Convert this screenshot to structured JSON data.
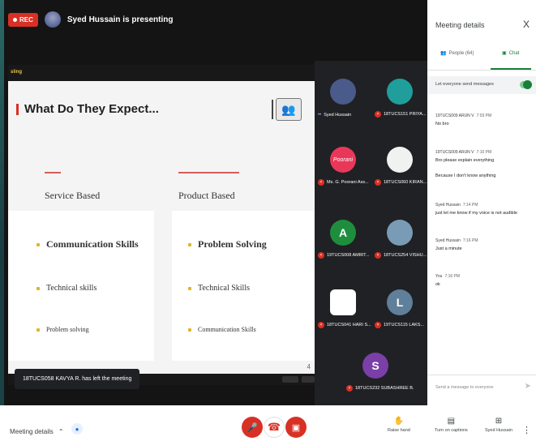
{
  "top": {
    "rec_label": "REC",
    "presenting": "Syed Hussain is presenting"
  },
  "slide": {
    "title": "What Do They Expect...",
    "left_header": "Service Based",
    "right_header": "Product Based",
    "left_items": [
      "Communication Skills",
      "Technical skills",
      "Problem solving"
    ],
    "right_items": [
      "Problem Solving",
      "Technical Skills",
      "Communication Skills"
    ],
    "page_number": "4"
  },
  "toast": "18TUCS058 KAVYA R. has left the meeting",
  "participants": [
    {
      "name": "Syed Hussain",
      "avatar": "",
      "color": "#4a5a8a",
      "muted": false
    },
    {
      "name": "18TUCS151 PRIYA...",
      "avatar": "",
      "color": "#1f9e9b",
      "muted": true
    },
    {
      "name": "Ms. G. Poorani Ass...",
      "avatar": "Poorani",
      "color": "#e8385a",
      "muted": true
    },
    {
      "name": "18TUCS060 KIRAN...",
      "avatar": "",
      "color": "#f1f1f1",
      "muted": true
    },
    {
      "name": "19TUCS008 AMIRT...",
      "avatar": "A",
      "color": "#1e8e3e",
      "muted": true
    },
    {
      "name": "18TUCS254 VISHU...",
      "avatar": "",
      "color": "#7a9bb5",
      "muted": true
    },
    {
      "name": "18TUCS041 HARI S...",
      "avatar": "",
      "color": "#ffffff",
      "muted": true
    },
    {
      "name": "19TUCS115 LAKS...",
      "avatar": "L",
      "color": "#5f7f9a",
      "muted": true
    },
    {
      "name": "18TUCS232 SUBASHREE B.",
      "avatar": "S",
      "color": "#7b3fa8",
      "muted": true
    }
  ],
  "panel": {
    "title": "Meeting details",
    "close": "X",
    "people_tab": "People (64)",
    "chat_tab": "Chat",
    "setting": "Let everyone send messages",
    "messages": [
      {
        "sender": "19TUCS009 ARUN V",
        "time": "7:03 PM",
        "lines": [
          "No bro"
        ]
      },
      {
        "sender": "19TUCS009 ARUN V",
        "time": "7:10 PM",
        "lines": [
          "Bro please explain everything",
          "Because I don't know anything"
        ]
      },
      {
        "sender": "Syed Hussain",
        "time": "7:14 PM",
        "lines": [
          "just let me know if my voice is not audible"
        ]
      },
      {
        "sender": "Syed Hussain",
        "time": "7:16 PM",
        "lines": [
          "Just a minute"
        ]
      },
      {
        "sender": "You",
        "time": "7:16 PM",
        "lines": [
          "ok"
        ]
      }
    ],
    "send_placeholder": "Send a message to everyone"
  },
  "bottom": {
    "meeting_details": "Meeting details",
    "raise_hand": "Raise hand",
    "captions": "Turn on captions",
    "presenting": "Syed Hussain"
  }
}
